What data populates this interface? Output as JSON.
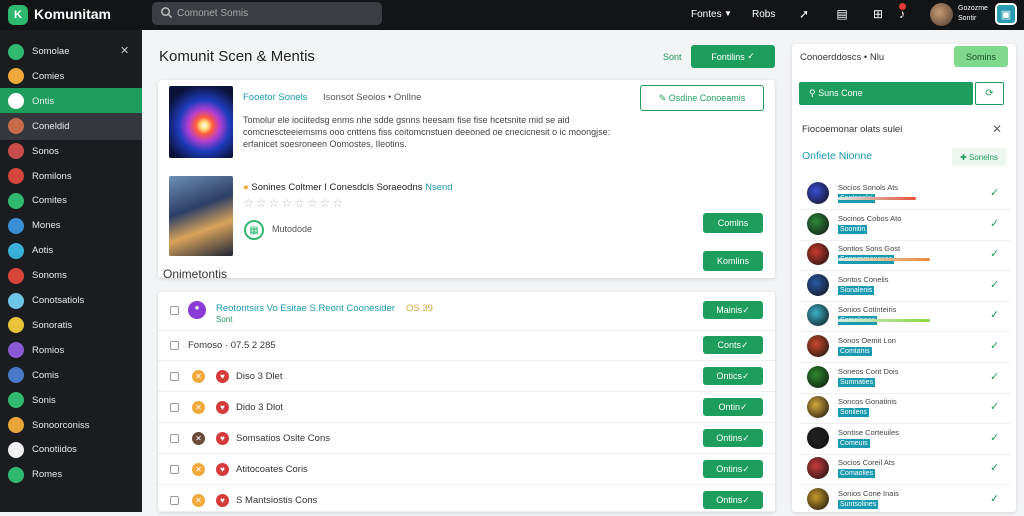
{
  "app": {
    "name": "Komunitam"
  },
  "topbar": {
    "search_value": "Comonet Somis",
    "links": [
      "Fontes",
      "Robs"
    ],
    "user_lines": [
      "Gozozme",
      "Sontir"
    ]
  },
  "sidebar": {
    "items": [
      {
        "label": "Somolae",
        "icon": "coin-icon",
        "color": "#2fb96f"
      },
      {
        "label": "Comies",
        "icon": "coin-icon",
        "color": "#f2a93b"
      },
      {
        "label": "Ontis",
        "icon": "chart-icon",
        "color": "#ffffff"
      },
      {
        "label": "Coneldid",
        "icon": "avatar-icon",
        "color": "#c86b4a"
      },
      {
        "label": "Sonos",
        "icon": "game-icon",
        "color": "#c94c4c"
      },
      {
        "label": "Romilons",
        "icon": "game-icon",
        "color": "#d6463a"
      },
      {
        "label": "Comites",
        "icon": "game-icon",
        "color": "#2fb96f"
      },
      {
        "label": "Mones",
        "icon": "game-icon",
        "color": "#3a8ed6"
      },
      {
        "label": "Aotis",
        "icon": "game-icon",
        "color": "#3ab0d6"
      },
      {
        "label": "Sonoms",
        "icon": "game-icon",
        "color": "#d6463a"
      },
      {
        "label": "Conotsatiols",
        "icon": "game-icon",
        "color": "#6ec5e8"
      },
      {
        "label": "Sonoratis",
        "icon": "game-icon",
        "color": "#e8c23a"
      },
      {
        "label": "Romios",
        "icon": "game-icon",
        "color": "#8a5ad6"
      },
      {
        "label": "Comis",
        "icon": "game-icon",
        "color": "#4a78c8"
      },
      {
        "label": "Sonis",
        "icon": "game-icon",
        "color": "#2fb96f"
      },
      {
        "label": "Sonoorconiss",
        "icon": "game-icon",
        "color": "#e8a53a"
      },
      {
        "label": "Conotiidos",
        "icon": "game-icon",
        "color": "#f0f0f0"
      },
      {
        "label": "Romes",
        "icon": "game-icon",
        "color": "#2fb96f"
      }
    ]
  },
  "main": {
    "title": "Komunit Scen & Mentis",
    "head_link": "Sont",
    "head_button": "Fontilins",
    "card": {
      "title": "Fooetor Sonels",
      "subtitle": "Isonsot Seoios • Onllne",
      "description": "Tomolur ele iociitedsg enms nhe sdde gsnns heesam fise fise hcetsnite mid se aid comcnescteeiemsms ooo cnttens fiss coitomcnstuen deeoned oe cnecicnesit o ic moongjse: erfanicet soesroneen Oomostes, Ileotins.",
      "outline_button": "Osdine Conoeamis",
      "item2_title": "Sonines Coltmer I Conesdcls Soraeodns",
      "item2_badge": "Nsend",
      "item2_meta": "Mutodode",
      "btn1": "Comlns",
      "btn2": "Komlins"
    },
    "section_title": "Onimetontis",
    "rows": [
      {
        "text": "Reotontsirs Vo Esitae S.Reont Coonesider",
        "extra": "OS  39",
        "sub": "Sont",
        "button": "Mainis"
      },
      {
        "text": "Fomoso · 07.5 2 285",
        "button": "Conts"
      },
      {
        "text": "Diso 3 Dlet",
        "button": "Ontics"
      },
      {
        "text": "Dido 3 Dlot",
        "button": "Ontin"
      },
      {
        "text": "Somsatios Oslte Cons",
        "button": "Ontins"
      },
      {
        "text": "Atitocoates Coris",
        "button": "Ontins"
      },
      {
        "text": "S Mantsiostis Cons",
        "button": "Ontins"
      }
    ]
  },
  "rightpanel": {
    "header": "Conoerddoscs • Nlu",
    "header_button": "Somins",
    "tab_label": "Suns Cone",
    "filter_label": "Fiocoemonar olats sulei",
    "section_title": "Onfiete Nionne",
    "section_button": "Sonelns",
    "items": [
      {
        "name": "Socios Sonols Ats",
        "sub": "Sontonelsi",
        "avatar_color": "#3a4ed6",
        "bar": "#e8503a"
      },
      {
        "name": "Socinos Cobos Ato",
        "sub": "Soonitin",
        "avatar_color": "#2a8a3a",
        "bar": ""
      },
      {
        "name": "Sontios Sons Gost",
        "sub": "Sonesnmoneses",
        "avatar_color": "#c93a2a",
        "bar": "#e88a3a"
      },
      {
        "name": "Sontos Conelis",
        "sub": "Sionalenis",
        "avatar_color": "#2a5aa8",
        "bar": ""
      },
      {
        "name": "Sonios Cotinteiris",
        "sub": "Somnlnees",
        "avatar_color": "#3ab0c8",
        "bar": "#8ad63a"
      },
      {
        "name": "Sonos Oemit Lon",
        "sub": "Comtanis",
        "avatar_color": "#c84a2a",
        "bar": ""
      },
      {
        "name": "Soneos Cont Dois",
        "sub": "Sumnaties",
        "avatar_color": "#2a8a2a",
        "bar": ""
      },
      {
        "name": "Soncos Gonatinis",
        "sub": "Sonilens",
        "avatar_color": "#d6a83a",
        "bar": ""
      },
      {
        "name": "Sontise Corteuiles",
        "sub": "Comeuis",
        "avatar_color": "#222222",
        "bar": ""
      },
      {
        "name": "Socios Coreil Ats",
        "sub": "Comaolies",
        "avatar_color": "#c83a3a",
        "bar": ""
      },
      {
        "name": "Sonios Cone Inais",
        "sub": "Suntsolines",
        "avatar_color": "#c89a2a",
        "bar": ""
      }
    ]
  },
  "colors": {
    "accent": "#1e9e5c",
    "link": "#1a9ab0",
    "topbar": "#121416",
    "sidebar": "#1a1c1f"
  }
}
